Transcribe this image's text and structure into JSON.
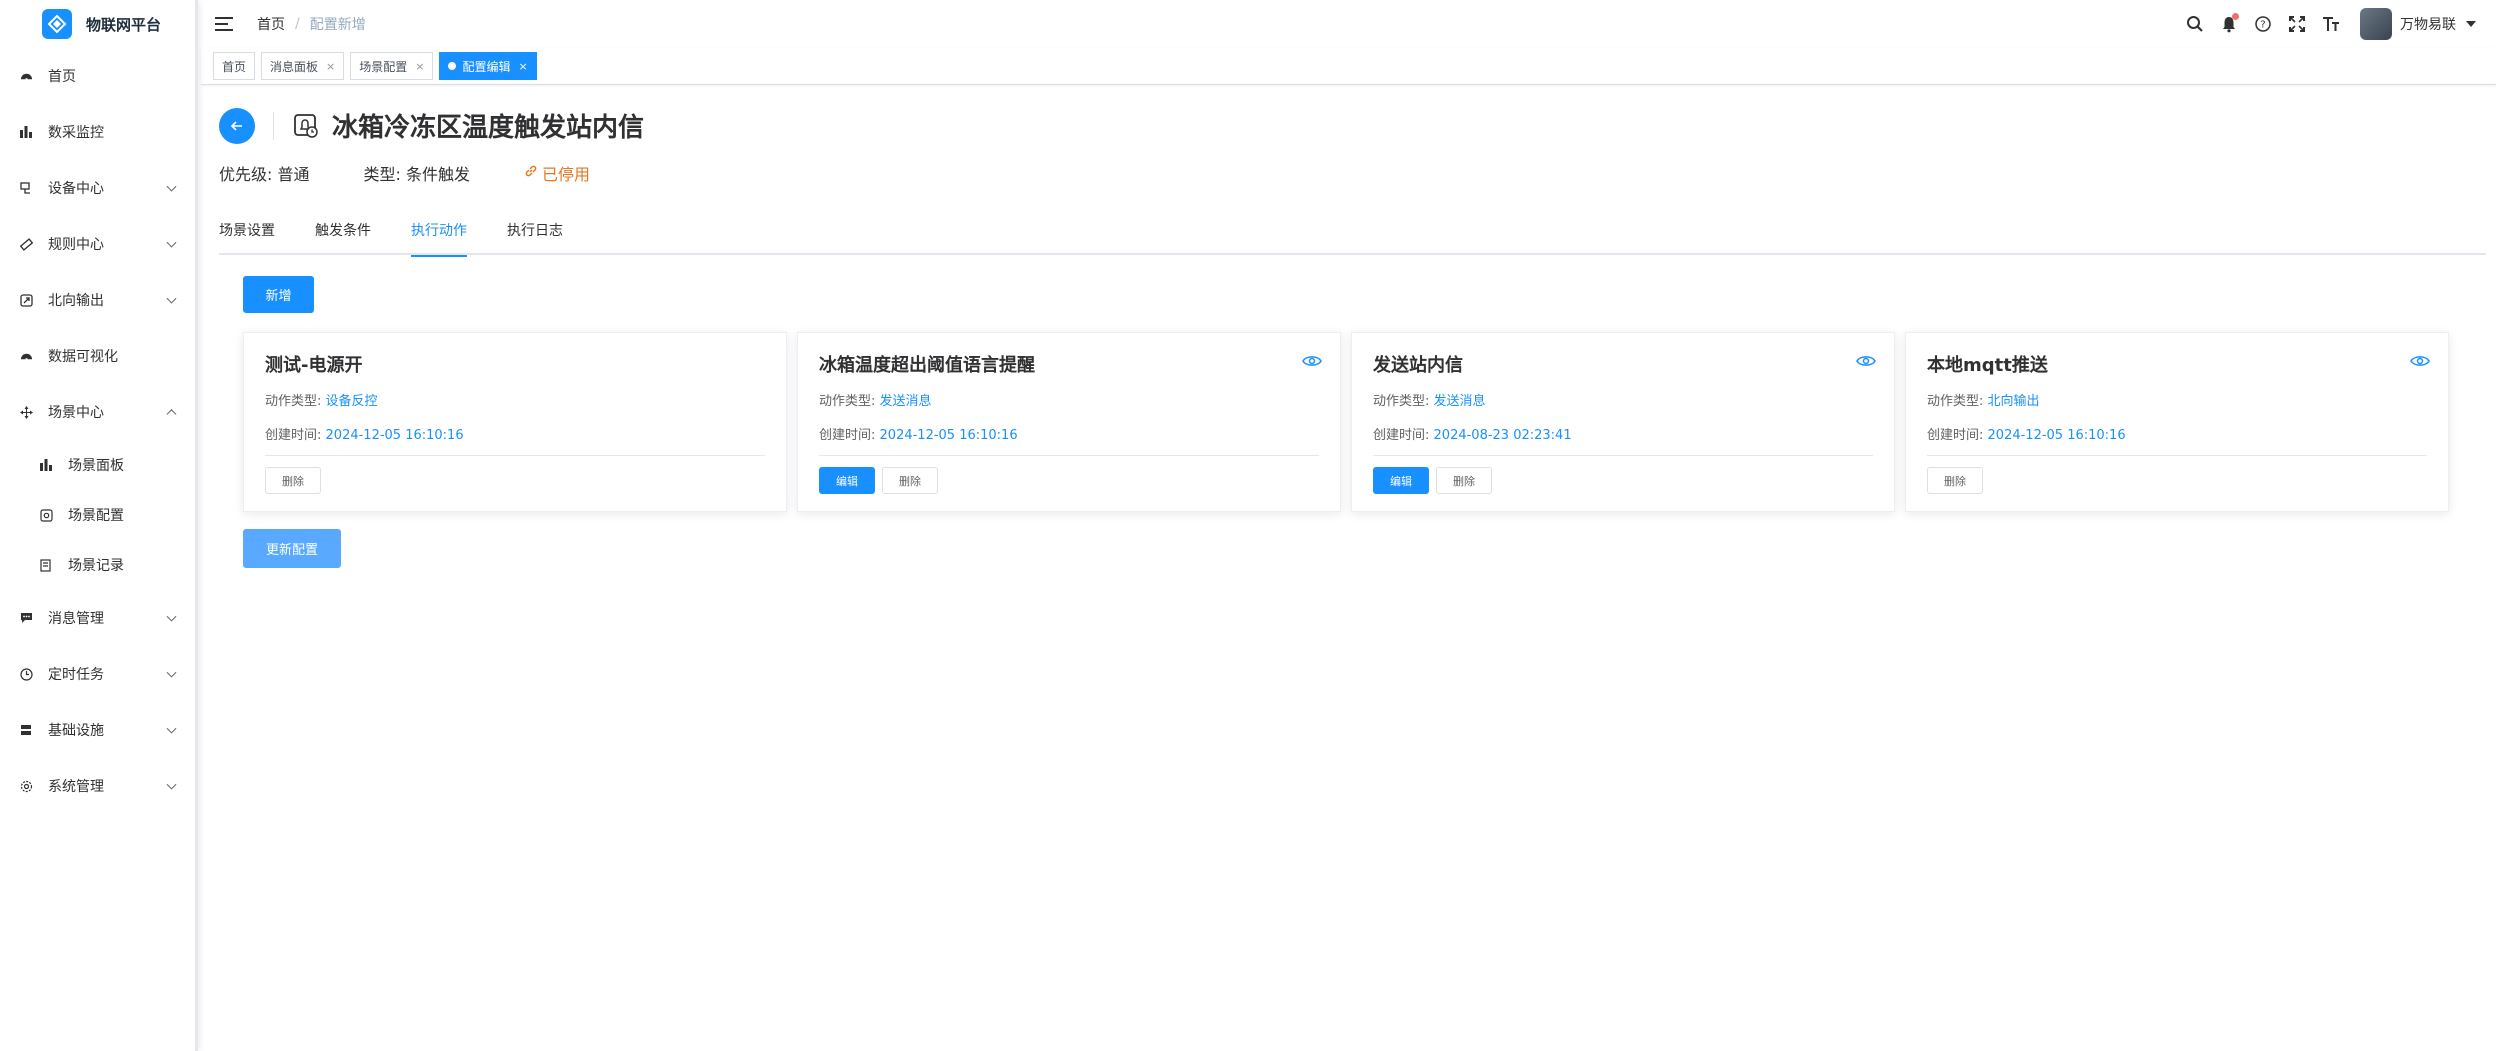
{
  "sidebar": {
    "app_title": "物联网平台",
    "items": [
      {
        "label": "首页",
        "icon": "dashboard-icon",
        "has_arrow": false
      },
      {
        "label": "数采监控",
        "icon": "bar-chart-icon",
        "has_arrow": false
      },
      {
        "label": "设备中心",
        "icon": "device-icon",
        "has_arrow": true
      },
      {
        "label": "规则中心",
        "icon": "ruler-icon",
        "has_arrow": true
      },
      {
        "label": "北向输出",
        "icon": "export-icon",
        "has_arrow": true
      },
      {
        "label": "数据可视化",
        "icon": "dashboard-icon",
        "has_arrow": false
      },
      {
        "label": "场景中心",
        "icon": "move-icon",
        "has_arrow": true,
        "expanded": true
      },
      {
        "label": "消息管理",
        "icon": "message-icon",
        "has_arrow": true
      },
      {
        "label": "定时任务",
        "icon": "clock-icon",
        "has_arrow": true
      },
      {
        "label": "基础设施",
        "icon": "server-icon",
        "has_arrow": true
      },
      {
        "label": "系统管理",
        "icon": "settings-icon",
        "has_arrow": true
      }
    ],
    "scene_submenu": [
      {
        "label": "场景面板",
        "icon": "bar-chart-icon"
      },
      {
        "label": "场景配置",
        "icon": "scene-config-icon"
      },
      {
        "label": "场景记录",
        "icon": "record-icon"
      }
    ]
  },
  "header": {
    "breadcrumb_home": "首页",
    "breadcrumb_sep": "/",
    "breadcrumb_current": "配置新增",
    "username": "万物易联"
  },
  "tags": [
    {
      "label": "首页",
      "closable": false,
      "active": false
    },
    {
      "label": "消息面板",
      "closable": true,
      "active": false
    },
    {
      "label": "场景配置",
      "closable": true,
      "active": false
    },
    {
      "label": "配置编辑",
      "closable": true,
      "active": true
    }
  ],
  "page": {
    "title": "冰箱冷冻区温度触发站内信",
    "priority": "优先级: 普通",
    "type": "类型: 条件触发",
    "status": "已停用",
    "status_color": "#e6771f",
    "accent": "#1890ff"
  },
  "tabs": [
    {
      "label": "场景设置",
      "active": false
    },
    {
      "label": "触发条件",
      "active": false
    },
    {
      "label": "执行动作",
      "active": true
    },
    {
      "label": "执行日志",
      "active": false
    }
  ],
  "add_button": "新增",
  "update_button": "更新配置",
  "cards": [
    {
      "title": "测试-电源开",
      "type_label": "动作类型:",
      "type_value": "设备反控",
      "time_label": "创建时间:",
      "time_value": "2024-12-05 16:10:16",
      "has_view": false,
      "edit_label": "",
      "delete_label": "删除"
    },
    {
      "title": "冰箱温度超出阈值语言提醒",
      "type_label": "动作类型:",
      "type_value": "发送消息",
      "time_label": "创建时间:",
      "time_value": "2024-12-05 16:10:16",
      "has_view": true,
      "edit_label": "编辑",
      "delete_label": "删除"
    },
    {
      "title": "发送站内信",
      "type_label": "动作类型:",
      "type_value": "发送消息",
      "time_label": "创建时间:",
      "time_value": "2024-08-23 02:23:41",
      "has_view": true,
      "edit_label": "编辑",
      "delete_label": "删除"
    },
    {
      "title": "本地mqtt推送",
      "type_label": "动作类型:",
      "type_value": "北向输出",
      "time_label": "创建时间:",
      "time_value": "2024-12-05 16:10:16",
      "has_view": true,
      "edit_label": "",
      "delete_label": "删除"
    }
  ]
}
